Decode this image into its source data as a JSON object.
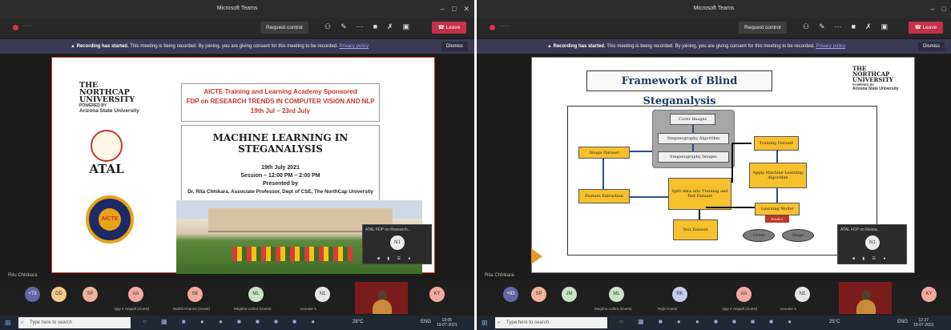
{
  "left": {
    "window_title": "Microsoft Teams",
    "toolbar": {
      "request_control": "Request control",
      "leave": "Leave"
    },
    "banner": {
      "title": "Recording has started.",
      "text": "This meeting is being recorded. By joining, you are giving consent for this meeting to be recorded.",
      "link": "Privacy policy",
      "dismiss": "Dismiss"
    },
    "slide": {
      "logo_line1": "THE",
      "logo_line2": "NORTHCAP",
      "logo_line3": "UNIVERSITY",
      "logo_powered": "POWERED BY",
      "logo_asu": "Arizona State University",
      "box1_line1": "AICTE Training and Learning Academy Sponsored",
      "box1_line2": "FDP on RESEARCH TRENDS IN COMPUTER VISION AND NLP",
      "box1_line3": "19th Jul – 23rd July",
      "title": "MACHINE LEARNING IN STEGANALYSIS",
      "date": "19th July 2021",
      "session": "Session – 12:00 PM – 2:00 PM",
      "presented": "Presented by",
      "presenter_line": "Dr. Rita Chhikara, Associate Professor, Dept of CSE, The NorthCap University",
      "atal": "ATAL",
      "aicte": "AICTE"
    },
    "mini": {
      "title": "ATAL FDP on Research...",
      "avatar": "N1"
    },
    "presenter_name": "Ritu Chhikara",
    "participants": [
      {
        "initials": "+73",
        "name": "",
        "color": "#6264a7"
      },
      {
        "initials": "DD",
        "name": "",
        "color": "#f4c98b"
      },
      {
        "initials": "SP",
        "name": "",
        "color": "#f0b49a"
      },
      {
        "initials": "AA",
        "name": "Ajay K Angadi (Guest)",
        "color": "#f4a9a0"
      },
      {
        "initials": "SK",
        "name": "Surbhi Khanna (Guest)",
        "color": "#f4a9a0"
      },
      {
        "initials": "ML",
        "name": "Meghna Luthra (Guest)",
        "color": "#c9e4c5"
      },
      {
        "initials": "N1",
        "name": "ncouser 1",
        "color": "#e6e6e6"
      },
      {
        "initials": "KY",
        "name": "",
        "color": "#f4a9a0"
      }
    ],
    "taskbar": {
      "search": "Type here to search",
      "weather": "28°C",
      "lang": "ENG",
      "time": "13:05",
      "date": "19-07-2021"
    }
  },
  "right": {
    "window_title": "Microsoft Teams",
    "toolbar": {
      "request_control": "Request control",
      "leave": "Leave"
    },
    "banner": {
      "title": "Recording has started.",
      "text": "This meeting is being recorded. By joining, you are giving consent for this meeting to be recorded.",
      "link": "Privacy policy",
      "dismiss": "Dismiss"
    },
    "slide": {
      "title": "Framework of Blind Steganalysis",
      "logo_line1": "THE",
      "logo_line2": "NORTHCAP",
      "logo_line3": "UNIVERSITY",
      "logo_powered": "POWERED BY",
      "logo_asu": "Arizona State University",
      "nodes": {
        "cover": "Cover Images",
        "algo": "Steganography Algorithm",
        "stego_imgs": "Steganography Images",
        "image_dataset": "Image Dataset",
        "feature": "Feature Extraction",
        "split": "Split data into Training and Test Dataset",
        "training": "Training Dataset",
        "apply": "Apply Machine Learning Algorithm",
        "model": "Learning Model",
        "predict": "Predict",
        "test": "Test Dataset",
        "out_cover": "Cover",
        "out_stego": "Stego"
      }
    },
    "mini": {
      "title": "ATAL FDP on Resea...",
      "avatar": "N1"
    },
    "presenter_name": "Rita Chhikara",
    "participants": [
      {
        "initials": "+93",
        "name": "",
        "color": "#6264a7"
      },
      {
        "initials": "SP",
        "name": "",
        "color": "#f0b49a"
      },
      {
        "initials": "JM",
        "name": "",
        "color": "#c9e4c5"
      },
      {
        "initials": "ML",
        "name": "Meghna Luthra (Guest)",
        "color": "#c9e4c5"
      },
      {
        "initials": "RK",
        "name": "Rajiv Kumar",
        "color": "#c5cbf0"
      },
      {
        "initials": "AA",
        "name": "Ajay K Angadi (Guest)",
        "color": "#f4a9a0"
      },
      {
        "initials": "N1",
        "name": "ncouser 1",
        "color": "#e6e6e6"
      },
      {
        "initials": "KY",
        "name": "",
        "color": "#f4a9a0"
      }
    ],
    "taskbar": {
      "search": "Type here to search",
      "weather": "25°C",
      "lang": "ENG",
      "time": "12:27",
      "date": "19-07-2021"
    }
  }
}
